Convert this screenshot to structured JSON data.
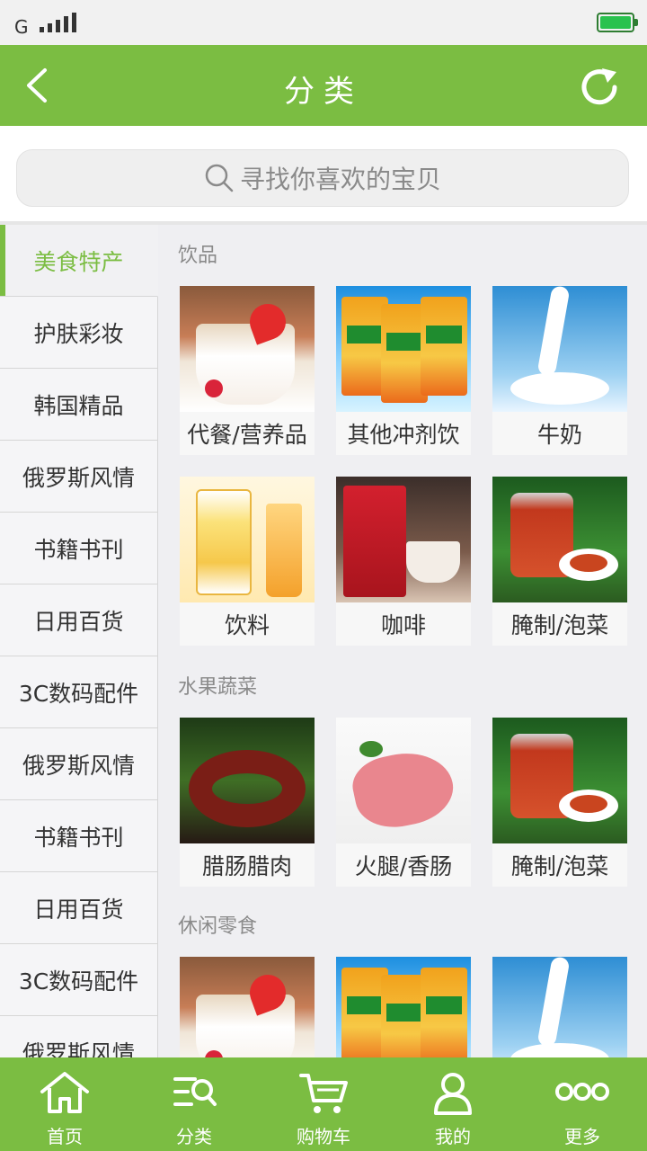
{
  "status": {
    "network": "G",
    "signal_bars": 5,
    "battery_percent": 100
  },
  "header": {
    "title": "分类",
    "back_icon": "chevron-left-icon",
    "refresh_icon": "refresh-icon"
  },
  "search": {
    "placeholder": "寻找你喜欢的宝贝",
    "icon": "search-icon"
  },
  "sidebar": {
    "active_index": 0,
    "items": [
      {
        "label": "美食特产"
      },
      {
        "label": "护肤彩妆"
      },
      {
        "label": "韩国精品"
      },
      {
        "label": "俄罗斯风情"
      },
      {
        "label": "书籍书刊"
      },
      {
        "label": "日用百货"
      },
      {
        "label": "3C数码配件"
      },
      {
        "label": "俄罗斯风情"
      },
      {
        "label": "书籍书刊"
      },
      {
        "label": "日用百货"
      },
      {
        "label": "3C数码配件"
      },
      {
        "label": "俄罗斯风情"
      }
    ]
  },
  "sections": [
    {
      "title": "饮品",
      "items": [
        {
          "label": "代餐/营养品",
          "image": "yogurt"
        },
        {
          "label": "其他冲剂饮",
          "image": "drink"
        },
        {
          "label": "牛奶",
          "image": "milk"
        },
        {
          "label": "饮料",
          "image": "juice"
        },
        {
          "label": "咖啡",
          "image": "coffee"
        },
        {
          "label": "腌制/泡菜",
          "image": "kimchi"
        }
      ]
    },
    {
      "title": "水果蔬菜",
      "items": [
        {
          "label": "腊肠腊肉",
          "image": "sausage"
        },
        {
          "label": "火腿/香肠",
          "image": "ham"
        },
        {
          "label": "腌制/泡菜",
          "image": "kimchi"
        }
      ]
    },
    {
      "title": "休闲零食",
      "items": [
        {
          "label": "",
          "image": "yogurt"
        },
        {
          "label": "",
          "image": "drink"
        },
        {
          "label": "",
          "image": "milk"
        }
      ]
    }
  ],
  "tabbar": {
    "active_index": 1,
    "tabs": [
      {
        "label": "首页",
        "icon": "home-icon"
      },
      {
        "label": "分类",
        "icon": "category-search-icon"
      },
      {
        "label": "购物车",
        "icon": "cart-icon"
      },
      {
        "label": "我的",
        "icon": "user-icon"
      },
      {
        "label": "更多",
        "icon": "more-icon"
      }
    ]
  },
  "colors": {
    "brand": "#7bbd42",
    "active_text": "#7bbd42"
  }
}
